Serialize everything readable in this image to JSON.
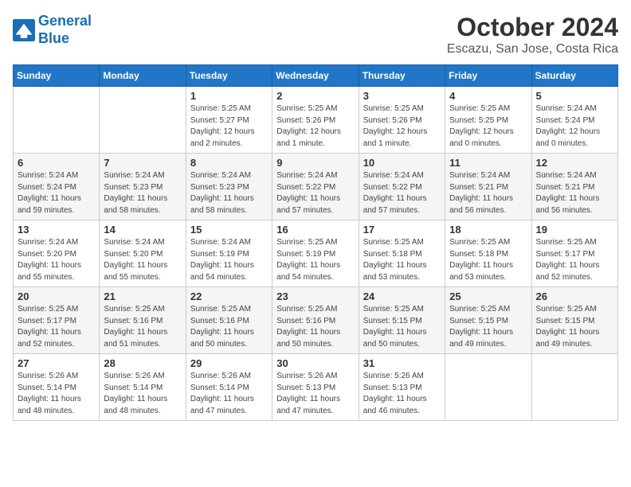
{
  "header": {
    "logo_line1": "General",
    "logo_line2": "Blue",
    "month_year": "October 2024",
    "location": "Escazu, San Jose, Costa Rica"
  },
  "weekdays": [
    "Sunday",
    "Monday",
    "Tuesday",
    "Wednesday",
    "Thursday",
    "Friday",
    "Saturday"
  ],
  "weeks": [
    [
      {
        "day": "",
        "info": ""
      },
      {
        "day": "",
        "info": ""
      },
      {
        "day": "1",
        "info": "Sunrise: 5:25 AM\nSunset: 5:27 PM\nDaylight: 12 hours\nand 2 minutes."
      },
      {
        "day": "2",
        "info": "Sunrise: 5:25 AM\nSunset: 5:26 PM\nDaylight: 12 hours\nand 1 minute."
      },
      {
        "day": "3",
        "info": "Sunrise: 5:25 AM\nSunset: 5:26 PM\nDaylight: 12 hours\nand 1 minute."
      },
      {
        "day": "4",
        "info": "Sunrise: 5:25 AM\nSunset: 5:25 PM\nDaylight: 12 hours\nand 0 minutes."
      },
      {
        "day": "5",
        "info": "Sunrise: 5:24 AM\nSunset: 5:24 PM\nDaylight: 12 hours\nand 0 minutes."
      }
    ],
    [
      {
        "day": "6",
        "info": "Sunrise: 5:24 AM\nSunset: 5:24 PM\nDaylight: 11 hours\nand 59 minutes."
      },
      {
        "day": "7",
        "info": "Sunrise: 5:24 AM\nSunset: 5:23 PM\nDaylight: 11 hours\nand 58 minutes."
      },
      {
        "day": "8",
        "info": "Sunrise: 5:24 AM\nSunset: 5:23 PM\nDaylight: 11 hours\nand 58 minutes."
      },
      {
        "day": "9",
        "info": "Sunrise: 5:24 AM\nSunset: 5:22 PM\nDaylight: 11 hours\nand 57 minutes."
      },
      {
        "day": "10",
        "info": "Sunrise: 5:24 AM\nSunset: 5:22 PM\nDaylight: 11 hours\nand 57 minutes."
      },
      {
        "day": "11",
        "info": "Sunrise: 5:24 AM\nSunset: 5:21 PM\nDaylight: 11 hours\nand 56 minutes."
      },
      {
        "day": "12",
        "info": "Sunrise: 5:24 AM\nSunset: 5:21 PM\nDaylight: 11 hours\nand 56 minutes."
      }
    ],
    [
      {
        "day": "13",
        "info": "Sunrise: 5:24 AM\nSunset: 5:20 PM\nDaylight: 11 hours\nand 55 minutes."
      },
      {
        "day": "14",
        "info": "Sunrise: 5:24 AM\nSunset: 5:20 PM\nDaylight: 11 hours\nand 55 minutes."
      },
      {
        "day": "15",
        "info": "Sunrise: 5:24 AM\nSunset: 5:19 PM\nDaylight: 11 hours\nand 54 minutes."
      },
      {
        "day": "16",
        "info": "Sunrise: 5:25 AM\nSunset: 5:19 PM\nDaylight: 11 hours\nand 54 minutes."
      },
      {
        "day": "17",
        "info": "Sunrise: 5:25 AM\nSunset: 5:18 PM\nDaylight: 11 hours\nand 53 minutes."
      },
      {
        "day": "18",
        "info": "Sunrise: 5:25 AM\nSunset: 5:18 PM\nDaylight: 11 hours\nand 53 minutes."
      },
      {
        "day": "19",
        "info": "Sunrise: 5:25 AM\nSunset: 5:17 PM\nDaylight: 11 hours\nand 52 minutes."
      }
    ],
    [
      {
        "day": "20",
        "info": "Sunrise: 5:25 AM\nSunset: 5:17 PM\nDaylight: 11 hours\nand 52 minutes."
      },
      {
        "day": "21",
        "info": "Sunrise: 5:25 AM\nSunset: 5:16 PM\nDaylight: 11 hours\nand 51 minutes."
      },
      {
        "day": "22",
        "info": "Sunrise: 5:25 AM\nSunset: 5:16 PM\nDaylight: 11 hours\nand 50 minutes."
      },
      {
        "day": "23",
        "info": "Sunrise: 5:25 AM\nSunset: 5:16 PM\nDaylight: 11 hours\nand 50 minutes."
      },
      {
        "day": "24",
        "info": "Sunrise: 5:25 AM\nSunset: 5:15 PM\nDaylight: 11 hours\nand 50 minutes."
      },
      {
        "day": "25",
        "info": "Sunrise: 5:25 AM\nSunset: 5:15 PM\nDaylight: 11 hours\nand 49 minutes."
      },
      {
        "day": "26",
        "info": "Sunrise: 5:25 AM\nSunset: 5:15 PM\nDaylight: 11 hours\nand 49 minutes."
      }
    ],
    [
      {
        "day": "27",
        "info": "Sunrise: 5:26 AM\nSunset: 5:14 PM\nDaylight: 11 hours\nand 48 minutes."
      },
      {
        "day": "28",
        "info": "Sunrise: 5:26 AM\nSunset: 5:14 PM\nDaylight: 11 hours\nand 48 minutes."
      },
      {
        "day": "29",
        "info": "Sunrise: 5:26 AM\nSunset: 5:14 PM\nDaylight: 11 hours\nand 47 minutes."
      },
      {
        "day": "30",
        "info": "Sunrise: 5:26 AM\nSunset: 5:13 PM\nDaylight: 11 hours\nand 47 minutes."
      },
      {
        "day": "31",
        "info": "Sunrise: 5:26 AM\nSunset: 5:13 PM\nDaylight: 11 hours\nand 46 minutes."
      },
      {
        "day": "",
        "info": ""
      },
      {
        "day": "",
        "info": ""
      }
    ]
  ]
}
